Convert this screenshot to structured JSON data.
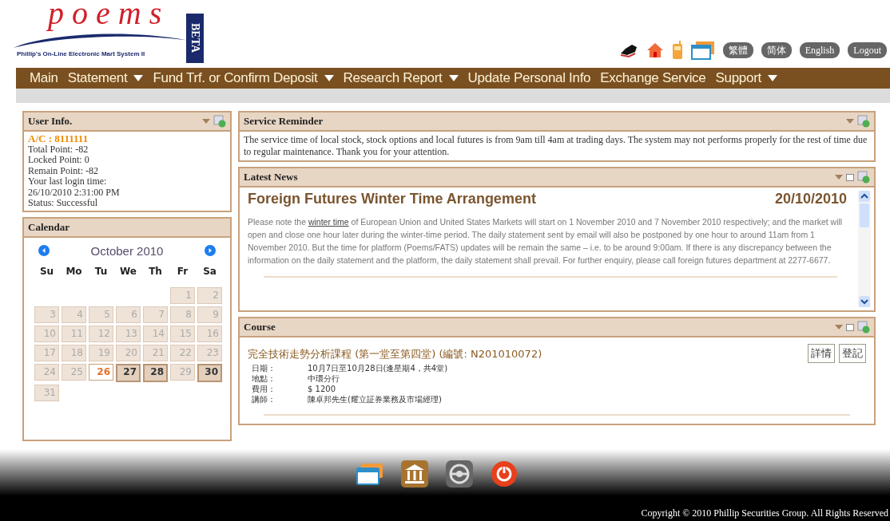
{
  "logo": {
    "wordmark": "poems",
    "tagline": "Phillip's On-Line Electronic Mart System II",
    "badge": "BETA"
  },
  "language_buttons": [
    {
      "label": "繁體"
    },
    {
      "label": "简体"
    },
    {
      "label": "English"
    },
    {
      "label": "Logout"
    }
  ],
  "nav": [
    {
      "label": "Main",
      "dropdown": false
    },
    {
      "label": "Statement",
      "dropdown": true
    },
    {
      "label": "Fund Trf. or Confirm Deposit",
      "dropdown": true
    },
    {
      "label": "Research Report",
      "dropdown": true
    },
    {
      "label": "Update Personal Info",
      "dropdown": false
    },
    {
      "label": "Exchange Service",
      "dropdown": false
    },
    {
      "label": "Support",
      "dropdown": true
    }
  ],
  "user_info": {
    "title": "User Info.",
    "collapse": true,
    "refresh": true,
    "account": "A/C : 8111111",
    "lines": [
      "Total Point: -82",
      "Locked Point: 0",
      "Remain Point: -82",
      "Your last login time:",
      "26/10/2010 2:31:00 PM",
      "Status: Successful"
    ]
  },
  "calendar": {
    "title": "Calendar",
    "month": "October 2010",
    "weekdays": [
      "Su",
      "Mo",
      "Tu",
      "We",
      "Th",
      "Fr",
      "Sa"
    ],
    "weeks": [
      [
        {
          "day": "1",
          "kind": "past"
        },
        {
          "day": "2",
          "kind": "past"
        }
      ],
      [
        {
          "day": "3",
          "kind": "past"
        },
        {
          "day": "4",
          "kind": "past"
        },
        {
          "day": "5",
          "kind": "past"
        },
        {
          "day": "6",
          "kind": "past"
        },
        {
          "day": "7",
          "kind": "past"
        },
        {
          "day": "8",
          "kind": "past"
        },
        {
          "day": "9",
          "kind": "past"
        }
      ],
      [
        {
          "day": "10",
          "kind": "past"
        },
        {
          "day": "11",
          "kind": "past"
        },
        {
          "day": "12",
          "kind": "past"
        },
        {
          "day": "13",
          "kind": "past"
        },
        {
          "day": "14",
          "kind": "past"
        },
        {
          "day": "15",
          "kind": "past"
        },
        {
          "day": "16",
          "kind": "past"
        }
      ],
      [
        {
          "day": "17",
          "kind": "past"
        },
        {
          "day": "18",
          "kind": "past"
        },
        {
          "day": "19",
          "kind": "past"
        },
        {
          "day": "20",
          "kind": "past"
        },
        {
          "day": "21",
          "kind": "past"
        },
        {
          "day": "22",
          "kind": "past"
        },
        {
          "day": "23",
          "kind": "past"
        }
      ],
      [
        {
          "day": "24",
          "kind": "past"
        },
        {
          "day": "25",
          "kind": "past"
        },
        {
          "day": "26",
          "kind": "today"
        },
        {
          "day": "27",
          "kind": "marked"
        },
        {
          "day": "28",
          "kind": "marked"
        },
        {
          "day": "29",
          "kind": "past"
        },
        {
          "day": "30",
          "kind": "marked"
        }
      ],
      [
        {
          "day": "31",
          "kind": "past"
        }
      ]
    ]
  },
  "service_reminder": {
    "title": "Service Reminder",
    "collapse": true,
    "refresh": true,
    "text": "The service time of local stock, stock options and local futures is from 9am till 4am at trading days. The system may not performs properly for the rest of time due to regular maintenance. Thank you for your attention."
  },
  "latest_news": {
    "title": "Latest News",
    "collapse": true,
    "maximize": true,
    "refresh": true,
    "headline": "Foreign Futures Winter Time Arrangement",
    "date": "20/10/2010",
    "body_before": "Please note the",
    "body_link": "winter time",
    "body_after": "of European Union and United States Markets will start on 1 November 2010 and 7 November 2010 respectively; and the market will open and close one hour later during the winter-time period. The daily statement sent by email will also be postponed by one hour to around 11am from 1 November 2010. But the time for platform (Poems/FATS) updates will be remain the same – i.e. to be around 9:00am. If there is any discrepancy between the information on the daily statement and the platform, the daily statement shall prevail. For further enquiry, please call foreign futures department at 2277-6677."
  },
  "course": {
    "title": "Course",
    "collapse": true,
    "maximize": true,
    "refresh": true,
    "name": "完全技術走勢分析課程 (第一堂至第四堂) (編號: N201010072)",
    "buttons": [
      "詳情",
      "登記"
    ],
    "details": [
      {
        "label": "日期：",
        "value": "10月7日至10月28日(逢星期4，共4堂)"
      },
      {
        "label": "地點：",
        "value": "中環分行"
      },
      {
        "label": "費用：",
        "value": "$ 1200"
      },
      {
        "label": "講師：",
        "value": "陳卓邦先生(耀立証券業務及市場經理)"
      }
    ]
  },
  "footer": {
    "copyright": "Copyright © 2010 Phillip Securities Group. All Rights Reserved"
  }
}
